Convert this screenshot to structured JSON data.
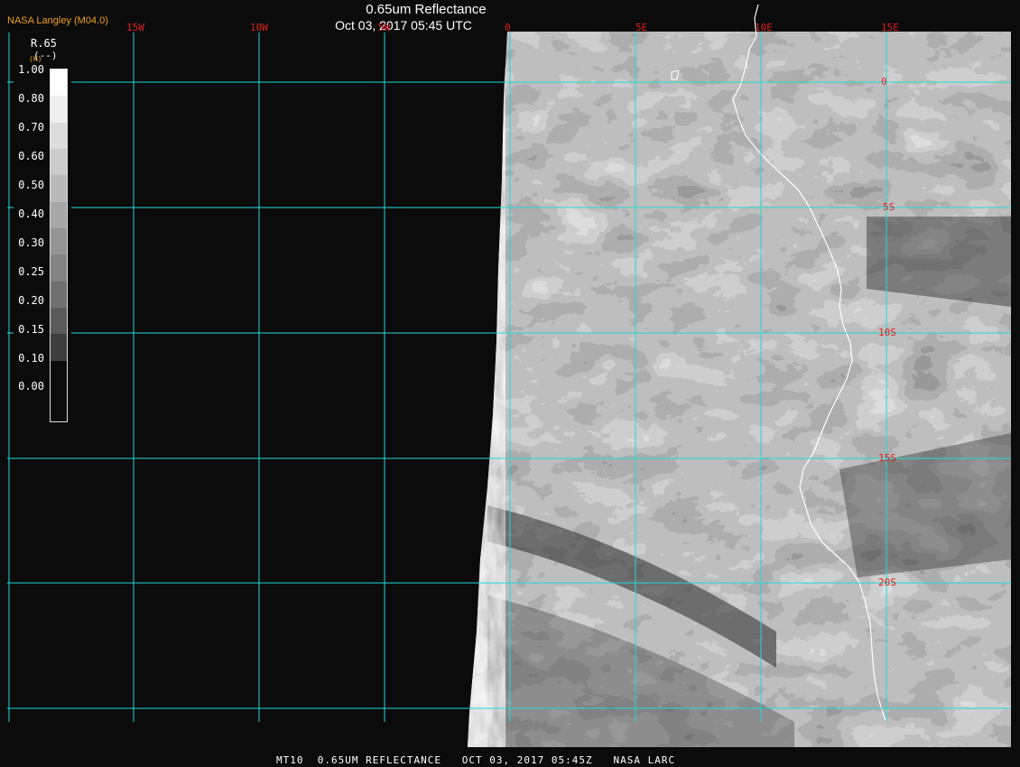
{
  "header": {
    "org": "NASA Langley (M04.0)",
    "title": "0.65um Reflectance",
    "datetime": "Oct 03, 2017 05:45 UTC"
  },
  "legend": {
    "title": "R.65",
    "units": "(--)",
    "marker": "(K)",
    "labels": [
      "1.00",
      "0.80",
      "0.70",
      "0.60",
      "0.50",
      "0.40",
      "0.30",
      "0.25",
      "0.20",
      "0.15",
      "0.10",
      "0.00"
    ],
    "shades": [
      "#ffffff",
      "#eeeeee",
      "#dcdcdc",
      "#cbcbcb",
      "#b9b9b9",
      "#a7a7a7",
      "#959595",
      "#838383",
      "#707070",
      "#5a5a5a",
      "#3e3e3e",
      "#0b0b0b"
    ]
  },
  "grid": {
    "color": "#22d8d8",
    "lon_labels": [
      "15W",
      "10W",
      "5W",
      "0",
      "5E",
      "10E",
      "15E"
    ],
    "lat_labels": [
      "0",
      "5S",
      "10S",
      "15S",
      "20S"
    ]
  },
  "colors": {
    "background": "#0b0b0b",
    "coastline": "#ffffff",
    "grid_label": "#e02020",
    "org_label": "#f0a020"
  },
  "footer": {
    "text": "MT10  0.65UM REFLECTANCE   OCT 03, 2017 05:45Z   NASA LARC"
  }
}
